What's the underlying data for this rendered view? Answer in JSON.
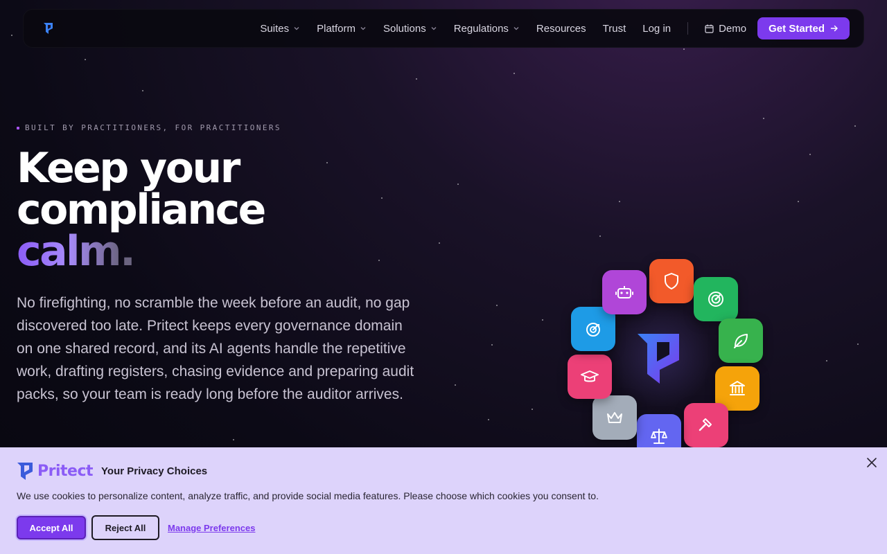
{
  "nav": {
    "items": [
      {
        "label": "Suites",
        "dropdown": true
      },
      {
        "label": "Platform",
        "dropdown": true
      },
      {
        "label": "Solutions",
        "dropdown": true
      },
      {
        "label": "Regulations",
        "dropdown": true
      },
      {
        "label": "Resources",
        "dropdown": false
      },
      {
        "label": "Trust",
        "dropdown": false
      }
    ],
    "login": "Log in",
    "demo": "Demo",
    "cta": "Get Started"
  },
  "hero": {
    "eyebrow": "BUILT BY PRACTITIONERS, FOR PRACTITIONERS",
    "line1": "Keep your",
    "line2": "compliance",
    "line3": "calm",
    "period": ".",
    "lead": "No firefighting, no scramble the week before an audit, no gap discovered too late. Pritect keeps every governance domain on one shared record, and its AI agents handle the repetitive work, drafting registers, chasing evidence and preparing audit packs, so your team is ready long before the auditor arrives."
  },
  "orbit_tiles": [
    {
      "icon": "shield-icon",
      "color": "#f25a2a"
    },
    {
      "icon": "radar-icon",
      "color": "#22b55e"
    },
    {
      "icon": "leaf-icon",
      "color": "#37b24d"
    },
    {
      "icon": "bank-icon",
      "color": "#f5a30a"
    },
    {
      "icon": "gavel-icon",
      "color": "#ec4077"
    },
    {
      "icon": "scales-icon",
      "color": "#6366f1"
    },
    {
      "icon": "crown-icon",
      "color": "#a3acb9"
    },
    {
      "icon": "graduation-cap-icon",
      "color": "#ec4077"
    },
    {
      "icon": "target-icon",
      "color": "#1e9be6"
    },
    {
      "icon": "robot-icon",
      "color": "#b046d8"
    }
  ],
  "cookie": {
    "brand": "Pritect",
    "title": "Your Privacy Choices",
    "text": "We use cookies to personalize content, analyze traffic, and provide social media features. Please choose which cookies you consent to.",
    "accept": "Accept All",
    "reject": "Reject All",
    "manage": "Manage Preferences"
  },
  "colors": {
    "accent": "#7c3aed",
    "banner": "#ddd3fb"
  }
}
